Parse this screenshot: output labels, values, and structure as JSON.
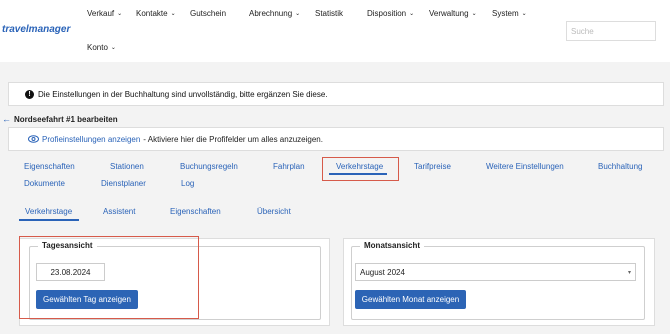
{
  "app": {
    "logo": "travelmanager"
  },
  "nav": {
    "items": [
      {
        "label": "Verkauf",
        "caret": true
      },
      {
        "label": "Kontakte",
        "caret": true
      },
      {
        "label": "Gutschein",
        "caret": false
      },
      {
        "label": "Abrechnung",
        "caret": true
      },
      {
        "label": "Statistik",
        "caret": false
      },
      {
        "label": "Disposition",
        "caret": true
      },
      {
        "label": "Verwaltung",
        "caret": true
      },
      {
        "label": "System",
        "caret": true
      },
      {
        "label": "Konto",
        "caret": true
      }
    ]
  },
  "search": {
    "placeholder": "Suche"
  },
  "alert": {
    "text": "Die Einstellungen in der Buchhaltung sind unvollständig, bitte ergänzen Sie diese."
  },
  "page": {
    "back_icon": "back-arrow-icon",
    "title": "Nordseefahrt #1 bearbeiten"
  },
  "hint": {
    "link": "Profieinstellungen anzeigen",
    "rest": "- Aktiviere hier die Profifelder um alles anzuzeigen."
  },
  "tabs": [
    "Eigenschaften",
    "Stationen",
    "Buchungsregeln",
    "Fahrplan",
    "Verkehrstage",
    "Tarifpreise",
    "Weitere Einstellungen",
    "Buchhaltung",
    "Dokumente",
    "Dienstplaner",
    "Log"
  ],
  "active_tab": "Verkehrstage",
  "subtabs": [
    "Verkehrstage",
    "Assistent",
    "Eigenschaften",
    "Übersicht"
  ],
  "day_view": {
    "legend": "Tagesansicht",
    "date": "23.08.2024",
    "button": "Gewählten Tag anzeigen"
  },
  "month_view": {
    "legend": "Monatsansicht",
    "selected": "August 2024",
    "button": "Gewählten Monat anzeigen"
  },
  "colors": {
    "accent": "#2c64b5",
    "highlight": "#d65a4a"
  }
}
